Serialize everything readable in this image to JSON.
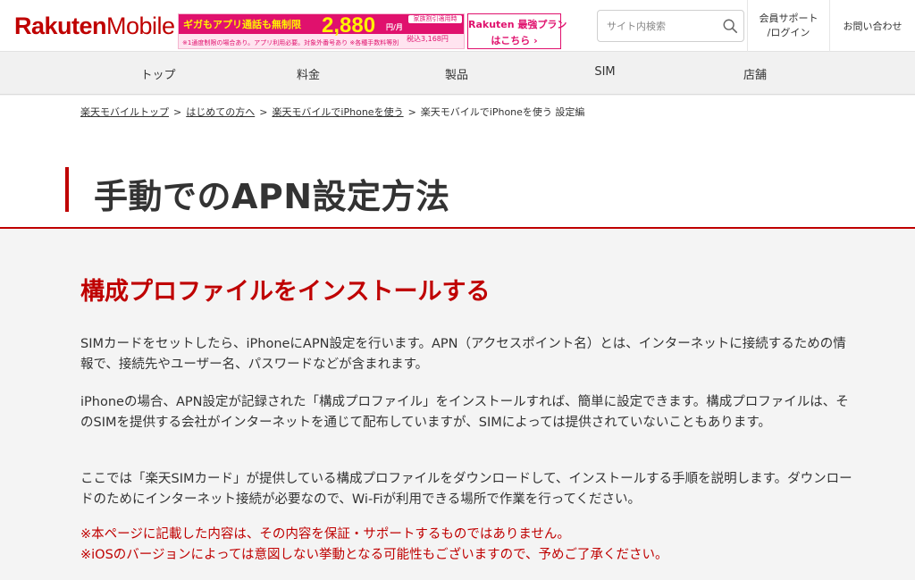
{
  "header": {
    "logo_brand": "Rakuten",
    "logo_product": "Mobile",
    "promo": {
      "lead": "ギガもアプリ通話も無制限",
      "price": "2,880",
      "family": "家族割引適用時",
      "unit": "円/月",
      "tax": "税込3,168円",
      "note": "※1通度制限の場合あり。アプリ利用必要。対象外番号あり ※各種手数料等別"
    },
    "plan_banner": {
      "line1": "Rakuten 最強プラン",
      "line2": "はこちら ›"
    },
    "search_placeholder": "サイト内検索",
    "member_line1": "会員サポート",
    "member_line2": "/ログイン",
    "contact": "お問い合わせ"
  },
  "nav": {
    "items": [
      {
        "label": "トップ"
      },
      {
        "label": "料金"
      },
      {
        "label": "製品"
      },
      {
        "label": "SIM"
      },
      {
        "label": "店舗"
      }
    ]
  },
  "breadcrumb": {
    "items": [
      {
        "label": "楽天モバイルトップ"
      },
      {
        "label": "はじめての方へ"
      },
      {
        "label": "楽天モバイルでiPhoneを使う"
      }
    ],
    "current": "楽天モバイルでiPhoneを使う 設定編",
    "separator": ">"
  },
  "page": {
    "title": "手動でのAPN設定方法",
    "heading": "構成プロファイルをインストールする",
    "para1": "SIMカードをセットしたら、iPhoneにAPN設定を行います。APN（アクセスポイント名）とは、インターネットに接続するための情報で、接続先やユーザー名、パスワードなどが含まれます。",
    "para2": "iPhoneの場合、APN設定が記録された「構成プロファイル」をインストールすれば、簡単に設定できます。構成プロファイルは、そのSIMを提供する会社がインターネットを通じて配布していますが、SIMによっては提供されていないこともあります。",
    "para3": "ここでは「楽天SIMカード」が提供している構成プロファイルをダウンロードして、インストールする手順を説明します。ダウンロードのためにインターネット接続が必要なので、Wi-Fiが利用できる場所で作業を行ってください。",
    "warning1": "※本ページに記載した内容は、その内容を保証・サポートするものではありません。",
    "warning2": "※iOSのバージョンによっては意図しない挙動となる可能性もございますので、予めご了承ください。"
  },
  "colors": {
    "brand_red": "#bf0000",
    "promo_pink": "#e0116d",
    "promo_yellow": "#fff200"
  }
}
